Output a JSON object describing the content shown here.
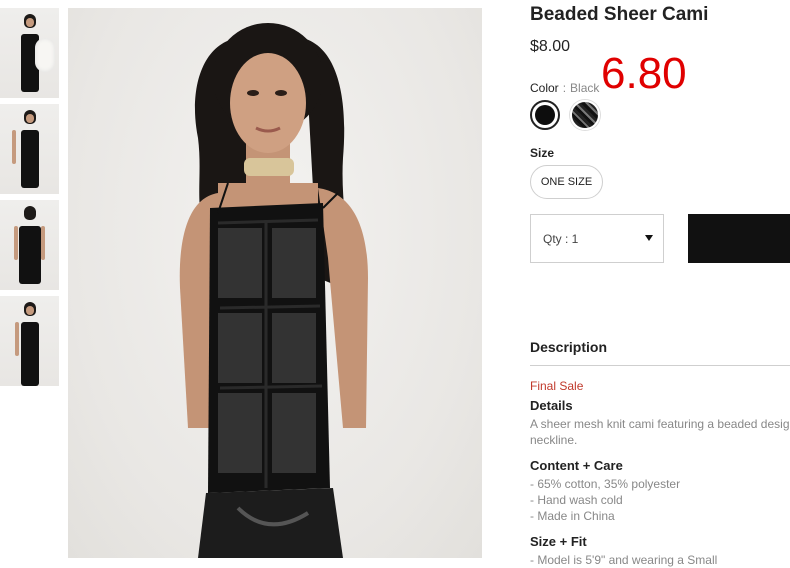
{
  "product": {
    "title": "Beaded Sheer Cami",
    "price": "$8.00",
    "price_overlay": "6.80"
  },
  "color": {
    "label": "Color",
    "separator": ":",
    "selected": "Black",
    "swatches": [
      "black",
      "black-pattern"
    ]
  },
  "size": {
    "label": "Size",
    "options": [
      "ONE SIZE"
    ]
  },
  "quantity": {
    "label": "Qty : 1"
  },
  "description": {
    "heading": "Description",
    "final_sale": "Final Sale",
    "details_heading": "Details",
    "details_line1": "A sheer mesh knit cami featuring a beaded desig",
    "details_line2": "neckline.",
    "content_heading": "Content + Care",
    "content_items": [
      "- 65% cotton, 35% polyester",
      "- Hand wash cold",
      "- Made in China"
    ],
    "size_fit_heading": "Size + Fit",
    "size_fit_line": "- Model is 5'9\" and wearing a Small"
  },
  "colors": {
    "final_sale": "#c0392b",
    "price_overlay": "#e00000",
    "add_button": "#111111"
  }
}
